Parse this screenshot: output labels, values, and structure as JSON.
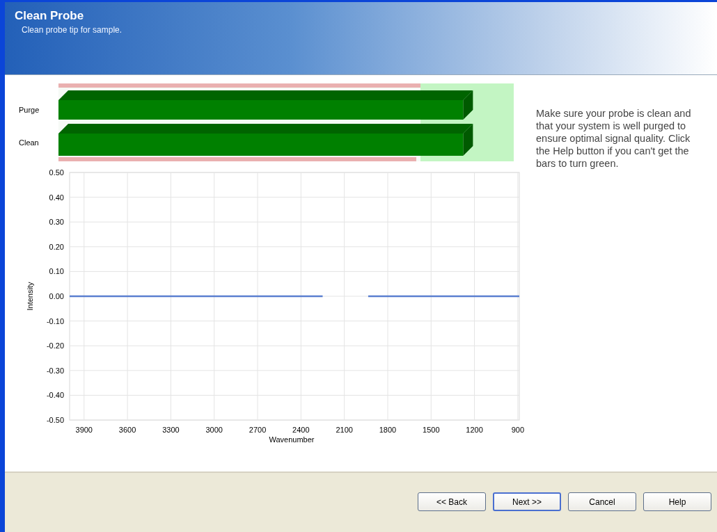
{
  "header": {
    "title": "Clean Probe",
    "subtitle": "Clean probe tip for sample."
  },
  "meters": [
    {
      "label": "Purge",
      "level": 0.9
    },
    {
      "label": "Clean",
      "level": 0.9
    }
  ],
  "instructions": "Make sure your probe is clean and that your system is well purged to ensure optimal signal quality. Click the Help button if you can't get the bars to turn green.",
  "chart_data": {
    "type": "line",
    "xlabel": "Wavenumber",
    "ylabel": "Intensity",
    "x": [
      4000,
      2250,
      2100,
      1935,
      890
    ],
    "series": [
      {
        "color": "#5b7fd0",
        "values": [
          0,
          0,
          null,
          0,
          0
        ]
      }
    ],
    "grid": true,
    "xlim": [
      4000,
      890
    ],
    "ylim": [
      -0.5,
      0.5
    ],
    "xticks": [
      3900,
      3600,
      3300,
      3000,
      2700,
      2400,
      2100,
      1800,
      1500,
      1200,
      900
    ],
    "yticks": [
      {
        "value": 0.5,
        "label": "0.50"
      },
      {
        "value": 0.4,
        "label": "0.40"
      },
      {
        "value": 0.3,
        "label": "0.30"
      },
      {
        "value": 0.2,
        "label": "0.20"
      },
      {
        "value": 0.1,
        "label": "0.10"
      },
      {
        "value": 0,
        "label": "0.00"
      },
      {
        "value": -0.1,
        "label": "-0.10"
      },
      {
        "value": -0.2,
        "label": "-0.20"
      },
      {
        "value": -0.3,
        "label": "-0.30"
      },
      {
        "value": -0.4,
        "label": "-0.40"
      },
      {
        "value": -0.5,
        "label": "-0.50"
      }
    ]
  },
  "buttons": [
    {
      "label": "<< Back",
      "default": false
    },
    {
      "label": "Next >>",
      "default": true
    },
    {
      "label": "Cancel",
      "default": false
    },
    {
      "label": "Help",
      "default": false
    }
  ]
}
